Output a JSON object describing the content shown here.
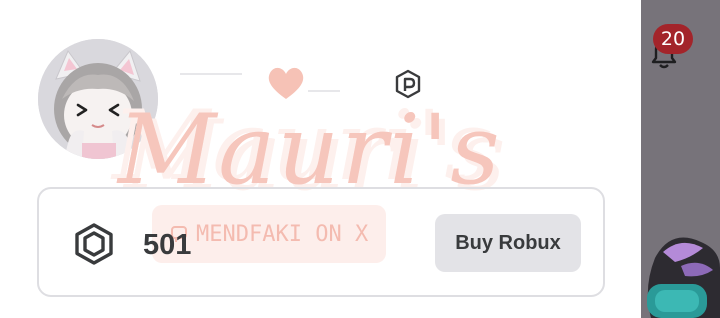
{
  "header": {
    "notification_count": "20",
    "avatar_icon": "user-avatar",
    "premium_icon": "premium-badge-icon"
  },
  "watermark": {
    "script_text": "Mauri's",
    "credit_text": "MENDFAKI ON X"
  },
  "robux": {
    "currency_icon": "robux-icon",
    "balance": "501",
    "buy_label": "Buy Robux"
  },
  "colors": {
    "badge": "#a3242a",
    "watermark": "#f6c6bc",
    "button_bg": "#e3e3e7",
    "text_dark": "#393b3d",
    "overlay": "#77737a"
  }
}
